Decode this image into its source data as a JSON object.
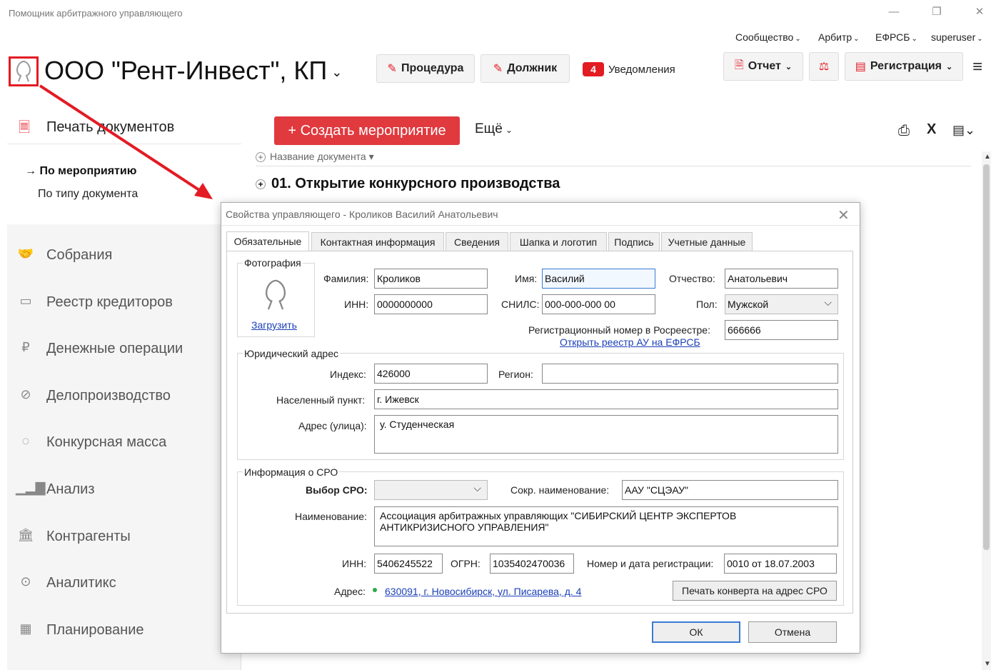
{
  "window": {
    "title": "Помощник арбитражного управляющего"
  },
  "topmenu": {
    "community": "Сообщество",
    "arbitr": "Арбитр",
    "efrsb": "ЕФРСБ",
    "user": "superuser"
  },
  "header": {
    "company": "ООО \"Рент-Инвест\", КП",
    "procedure_btn": "Процедура",
    "debtor_btn": "Должник",
    "notif_count": "4",
    "notif_label": "Уведомления",
    "report_btn": "Отчет",
    "registration_btn": "Регистрация"
  },
  "sidebar": {
    "active": "Печать документов",
    "sub": [
      "→ По мероприятию",
      "По типу документа"
    ],
    "items": [
      {
        "label": "Собрания",
        "icon": "handshake-icon"
      },
      {
        "label": "Реестр кредиторов",
        "icon": "id-card-icon"
      },
      {
        "label": "Денежные операции",
        "icon": "ruble-icon"
      },
      {
        "label": "Делопроизводство",
        "icon": "paperclip-icon"
      },
      {
        "label": "Конкурсная масса",
        "icon": "piggy-bank-icon"
      },
      {
        "label": "Анализ",
        "icon": "bar-chart-icon"
      },
      {
        "label": "Контрагенты",
        "icon": "bank-icon"
      },
      {
        "label": "Аналитикс",
        "icon": "search-icon"
      },
      {
        "label": "Планирование",
        "icon": "calendar-icon"
      }
    ]
  },
  "main": {
    "create_btn": "+ Создать мероприятие",
    "more_btn": "Ещё",
    "doc_header": "Название документа",
    "section": "01. Открытие конкурсного производства"
  },
  "dialog": {
    "title": "Свойства управляющего - Кроликов Василий Анатольевич",
    "tabs": [
      "Обязательные",
      "Контактная информация",
      "Сведения",
      "Шапка и логотип",
      "Подпись",
      "Учетные данные"
    ],
    "photo": {
      "group": "Фотография",
      "upload": "Загрузить"
    },
    "labels": {
      "surname": "Фамилия:",
      "name": "Имя:",
      "patronymic": "Отчество:",
      "inn": "ИНН:",
      "snils": "СНИЛС:",
      "sex": "Пол:",
      "regnum": "Регистрационный номер в Росреестре:",
      "open_registry": "Открыть реестр АУ на ЕФРСБ"
    },
    "values": {
      "surname": "Кроликов",
      "name": "Василий",
      "patronymic": "Анатольевич",
      "inn": "0000000000",
      "snils": "000-000-000 00",
      "sex": "Мужской",
      "regnum": "666666"
    },
    "address": {
      "group": "Юридический адрес",
      "index_label": "Индекс:",
      "index": "426000",
      "region_label": "Регион:",
      "region": "",
      "city_label": "Населенный пункт:",
      "city": "г. Ижевск",
      "street_label": "Адрес (улица):",
      "street": "у. Студенческая"
    },
    "sro": {
      "group": "Информация о СРО",
      "choose_label": "Выбор СРО:",
      "short_label": "Сокр. наименование:",
      "short": "ААУ \"СЦЭАУ\"",
      "full_label": "Наименование:",
      "full": "Ассоциация арбитражных управляющих \"СИБИРСКИЙ ЦЕНТР ЭКСПЕРТОВ АНТИКРИЗИСНОГО УПРАВЛЕНИЯ\"",
      "inn_label": "ИНН:",
      "inn": "5406245522",
      "ogrn_label": "ОГРН:",
      "ogrn": "1035402470036",
      "reg_label": "Номер и дата регистрации:",
      "reg": "0010 от 18.07.2003",
      "addr_label": "Адрес:",
      "addr": "630091, г. Новосибирск, ул. Писарева, д. 4",
      "print_btn": "Печать конверта на адрес СРО"
    },
    "ok": "ОК",
    "cancel": "Отмена"
  },
  "colors": {
    "accent": "#e31b23",
    "create": "#e0393e",
    "link": "#1a3fb8"
  }
}
